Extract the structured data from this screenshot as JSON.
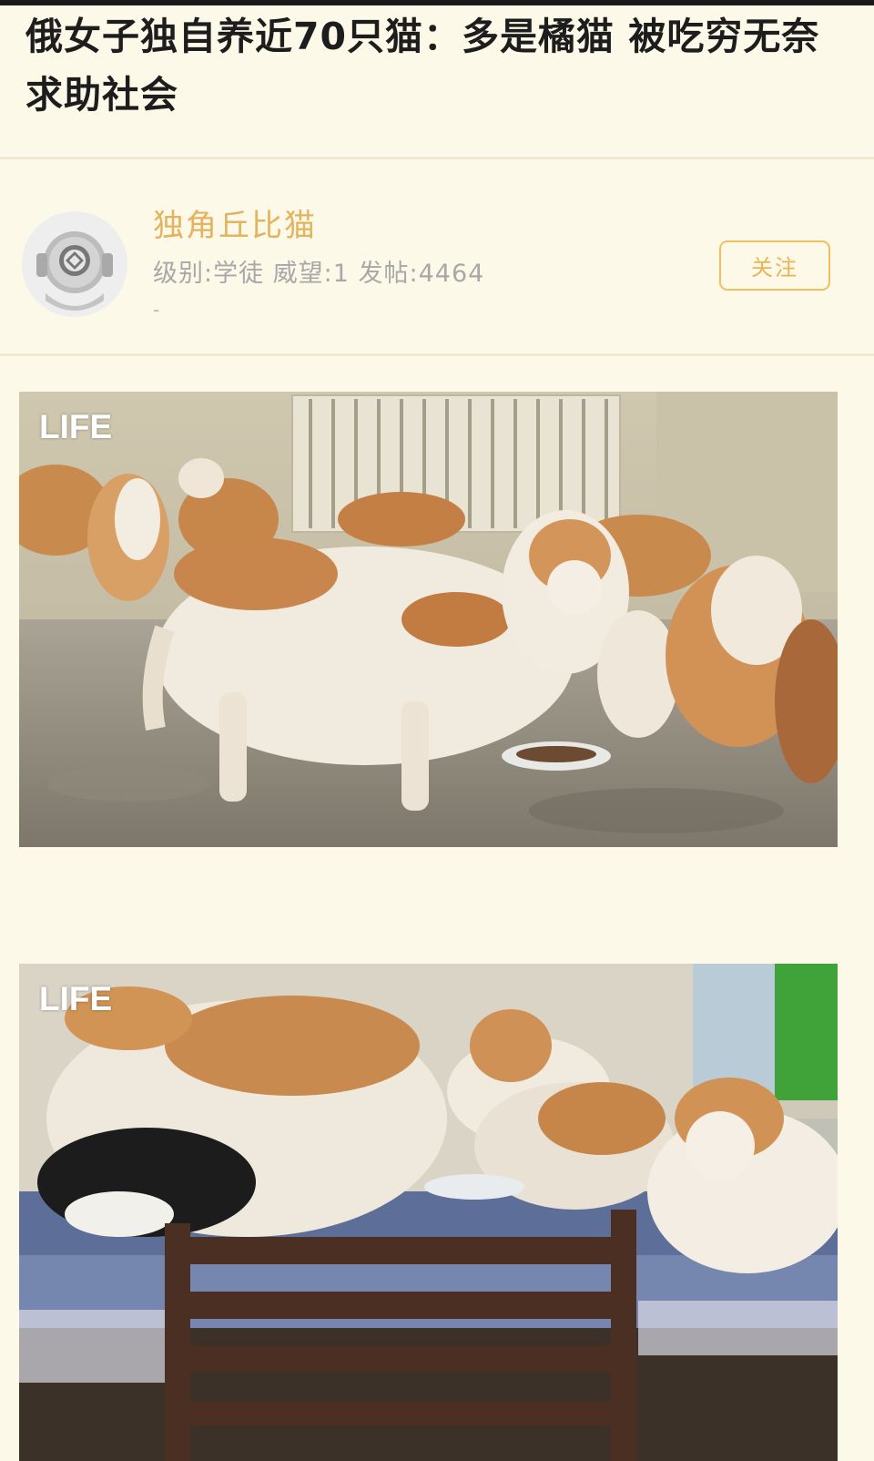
{
  "post": {
    "title": "俄女子独自养近70只猫：多是橘猫 被吃穷无奈求助社会"
  },
  "author": {
    "avatar_icon": "diving-helmet-avatar-icon",
    "name": "独角丘比猫",
    "stats": "级别:学徒 威望:1 发帖:4464",
    "sub": "-",
    "follow_label": "关注"
  },
  "images": [
    {
      "watermark": "LIFE"
    },
    {
      "watermark": "LIFE"
    }
  ],
  "colors": {
    "background": "#fdf9e8",
    "accent": "#e3b35e",
    "text": "#1d1d1d"
  }
}
